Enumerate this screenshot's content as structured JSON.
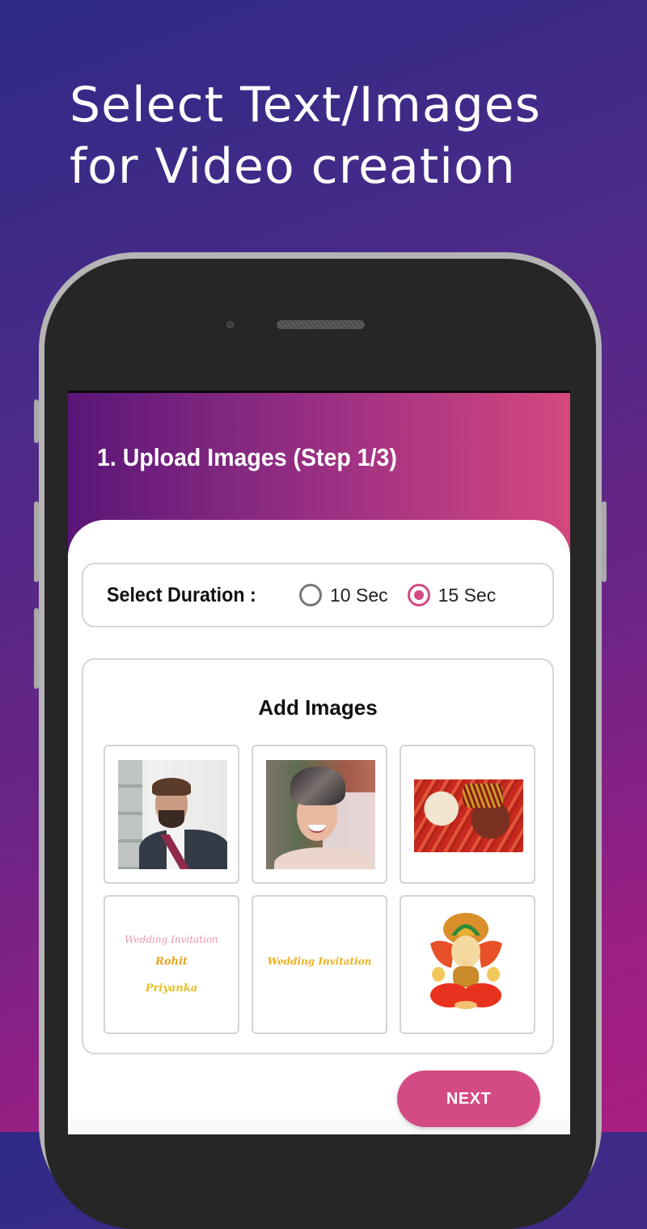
{
  "promo": {
    "headline_line1": "Select Text/Images",
    "headline_line2": "for Video creation"
  },
  "app": {
    "title": "1. Upload Images (Step 1/3)",
    "colors": {
      "accent": "#d44a85",
      "header_gradient_start": "#5a1677",
      "header_gradient_end": "#d5487f"
    }
  },
  "duration": {
    "label": "Select Duration :",
    "options": [
      {
        "label": "10 Sec",
        "selected": false
      },
      {
        "label": "15 Sec",
        "selected": true
      }
    ]
  },
  "images": {
    "title": "Add Images",
    "tiles": [
      {
        "type": "photo",
        "icon": "groom-portrait-image"
      },
      {
        "type": "photo",
        "icon": "bride-portrait-image"
      },
      {
        "type": "photo",
        "icon": "henna-hands-image"
      },
      {
        "type": "text",
        "lines": [
          "Wedding Invitation",
          "Rohit",
          "Priyanka"
        ]
      },
      {
        "type": "text",
        "lines": [
          "Wedding Invitation"
        ]
      },
      {
        "type": "photo",
        "icon": "ganesha-image"
      }
    ]
  },
  "actions": {
    "next_label": "NEXT"
  }
}
